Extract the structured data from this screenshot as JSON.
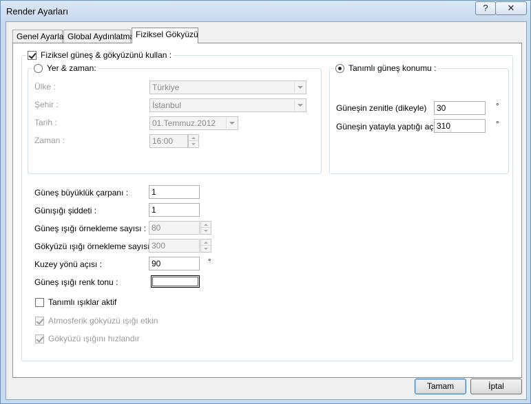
{
  "window": {
    "title": "Render Ayarları",
    "help_glyph": "?",
    "close_glyph": "✕"
  },
  "tabs": [
    {
      "label": "Genel Ayarlar"
    },
    {
      "label": "Global Aydınlatma"
    },
    {
      "label": "Fiziksel Gökyüzü"
    }
  ],
  "physical_sky": {
    "use_sun_sky_label": "Fiziksel güneş & gökyüzünü kullan :",
    "use_sun_sky_checked": true,
    "place_time": {
      "radio_label": "Yer & zaman:",
      "selected": false,
      "country_label": "Ülke :",
      "country_value": "Türkiye",
      "city_label": "Şehir :",
      "city_value": "İstanbul",
      "date_label": "Tarih :",
      "date_value": "01.Temmuz.2012",
      "time_label": "Zaman :",
      "time_value": "16:00"
    },
    "defined_sun": {
      "radio_label": "Tanımlı güneş konumu :",
      "selected": true,
      "zenith_label": "Güneşin zenitle (dikeyle)",
      "zenith_value": "30",
      "azimuth_label": "Güneşin yatayla yaptığı açı",
      "azimuth_value": "310",
      "degree_unit": "°"
    },
    "sun_size_label": "Güneş büyüklük çarpanı :",
    "sun_size_value": "1",
    "daylight_intensity_label": "Günışığı şiddeti :",
    "daylight_intensity_value": "1",
    "sun_samples_label": "Güneş ışığı örnekleme sayısı :",
    "sun_samples_value": "80",
    "sky_samples_label": "Gökyüzü ışığı örnekleme sayısı :",
    "sky_samples_value": "300",
    "north_angle_label": "Kuzey yönü açısı :",
    "north_angle_value": "90",
    "degree_unit": "°",
    "sun_color_label": "Güneş ışığı renk tonu  :",
    "sun_color": "#ffffff",
    "defined_lights_label": "Tanımlı ışıklar aktif",
    "defined_lights_checked": false,
    "atmospheric_label": "Atmosferik gökyüzü ışığı etkin",
    "atmospheric_checked": true,
    "accelerate_label": "Gökyüzü ışığını hızlandır",
    "accelerate_checked": true
  },
  "buttons": {
    "ok": "Tamam",
    "cancel": "İptal"
  }
}
